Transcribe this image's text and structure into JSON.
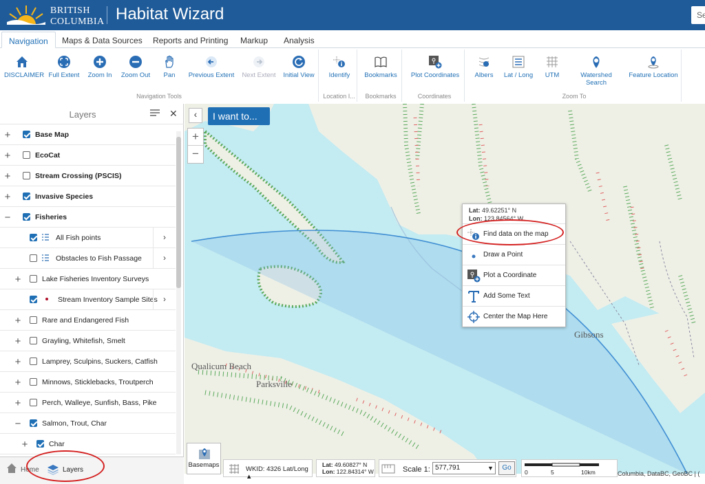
{
  "header": {
    "logo_line1": "BRITISH",
    "logo_line2": "COLUMBIA",
    "app_title": "Habitat Wizard",
    "search_placeholder": "Se"
  },
  "tabs": [
    {
      "label": "Navigation",
      "active": true
    },
    {
      "label": "Maps & Data Sources"
    },
    {
      "label": "Reports and Printing"
    },
    {
      "label": "Markup"
    },
    {
      "label": "Analysis"
    }
  ],
  "ribbon": {
    "navigation_tools": {
      "group_label": "Navigation Tools",
      "buttons": [
        "DISCLAIMER",
        "Full Extent",
        "Zoom In",
        "Zoom Out",
        "Pan",
        "Previous Extent",
        "Next Extent",
        "Initial View"
      ]
    },
    "location": {
      "group_label": "Location I...",
      "buttons": [
        "Identify"
      ]
    },
    "bookmarks": {
      "group_label": "Bookmarks",
      "buttons": [
        "Bookmarks"
      ]
    },
    "coordinates": {
      "group_label": "Coordinates",
      "buttons": [
        "Plot Coordinates"
      ]
    },
    "zoom_to": {
      "group_label": "Zoom To",
      "buttons": [
        "Albers",
        "Lat / Long",
        "UTM",
        "Watershed",
        "Search",
        "Feature Location"
      ]
    }
  },
  "layers_panel": {
    "title": "Layers",
    "items": [
      {
        "label": "Base Map",
        "checked": true
      },
      {
        "label": "EcoCat",
        "checked": false
      },
      {
        "label": "Stream Crossing (PSCIS)",
        "checked": false
      },
      {
        "label": "Invasive Species",
        "checked": true
      },
      {
        "label": "Fisheries",
        "checked": true
      },
      {
        "label": "All Fish points",
        "checked": true
      },
      {
        "label": "Obstacles to Fish Passage",
        "checked": false
      },
      {
        "label": "Lake Fisheries Inventory Surveys",
        "checked": false
      },
      {
        "label": "Stream Inventory Sample Sites",
        "checked": true
      },
      {
        "label": "Rare and Endangered Fish",
        "checked": false
      },
      {
        "label": "Grayling, Whitefish, Smelt",
        "checked": false
      },
      {
        "label": "Lamprey, Sculpins, Suckers, Catfish",
        "checked": false
      },
      {
        "label": "Minnows, Sticklebacks, Troutperch",
        "checked": false
      },
      {
        "label": "Perch, Walleye, Sunfish, Bass, Pike",
        "checked": false
      },
      {
        "label": "Salmon, Trout, Char",
        "checked": true
      },
      {
        "label": "Char",
        "checked": true
      }
    ]
  },
  "bottom_tabs": {
    "home": "Home",
    "layers": "Layers"
  },
  "map": {
    "i_want_to": "I want to...",
    "place_labels": [
      "Qualicum Beach",
      "Parksville",
      "Gibsons"
    ],
    "context_menu": {
      "lat_label": "Lat:",
      "lat_value": "49.62251° N",
      "lon_label": "Lon:",
      "lon_value": "123.84564° W",
      "items": [
        "Find data on the map",
        "Draw a Point",
        "Plot a Coordinate",
        "Add Some Text",
        "Center the Map Here"
      ]
    },
    "basemaps_label": "Basemaps",
    "wkid": "WKID: 4326 Lat/Long ▲",
    "cursor_lat_label": "Lat:",
    "cursor_lat": "49.60827° N",
    "cursor_lon_label": "Lon:",
    "cursor_lon": "122.84314° W",
    "scale_label": "Scale 1:",
    "scale_value": "577,791",
    "go_label": "Go",
    "scalebar_ticks": [
      "0",
      "5",
      "10km"
    ],
    "attribution": "Columbia, DataBC, GeoBC | ("
  },
  "colors": {
    "brand_blue": "#1f5b99",
    "accent_blue": "#1f6fb5",
    "water": "#c3ebf2",
    "land": "#eef0e6",
    "annotation_red": "#d42020"
  }
}
